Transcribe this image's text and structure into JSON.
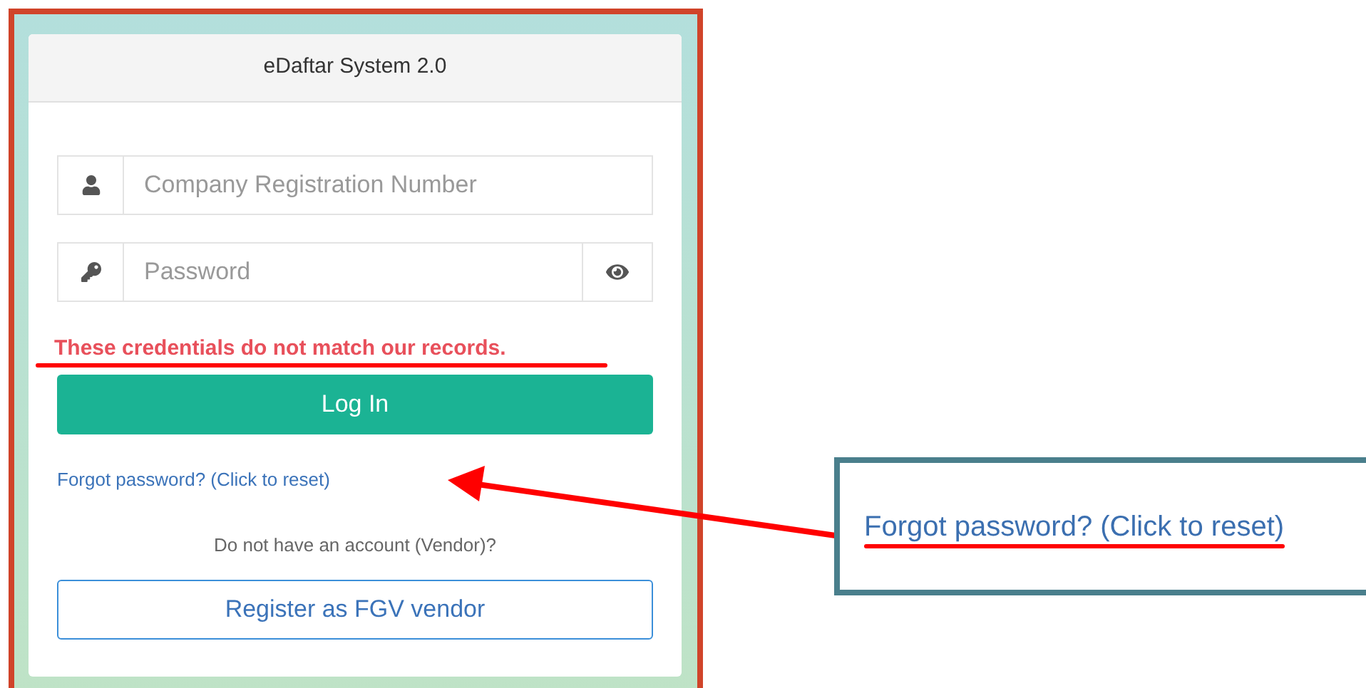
{
  "header": {
    "title": "eDaftar System 2.0"
  },
  "fields": [
    {
      "kind": "text",
      "placeholder": "Company Registration Number"
    },
    {
      "kind": "password",
      "placeholder": "Password"
    }
  ],
  "error": {
    "text": "These credentials do not match our records.",
    "underlined": true
  },
  "login_button": "Log In",
  "forgot_link": "Forgot password? (Click to reset)",
  "register_prompt": "Do not have an account (Vendor)?",
  "register_button": "Register as FGV vendor",
  "callout": {
    "text": "Forgot password? (Click to reset)",
    "underlined": true
  }
}
